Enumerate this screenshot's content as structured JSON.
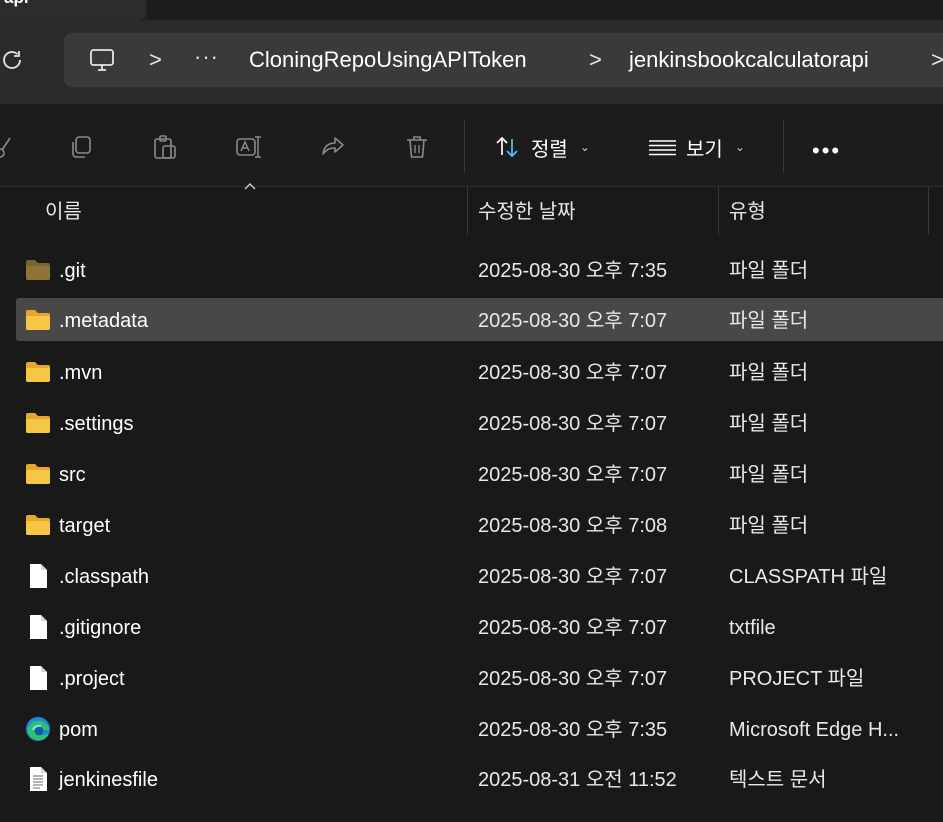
{
  "window": {
    "tab_title": "api"
  },
  "address": {
    "root_icon": "this-pc-icon",
    "overflow": "···",
    "crumbs": [
      "CloningRepoUsingAPIToken",
      "jenkinsbookcalculatorapi"
    ],
    "separator": ">"
  },
  "toolbar": {
    "icons": [
      "cut-icon",
      "copy-icon",
      "paste-icon",
      "rename-icon",
      "share-icon",
      "delete-icon"
    ],
    "sort_label": "정렬",
    "view_label": "보기",
    "more": "•••"
  },
  "columns": {
    "name": "이름",
    "date": "수정한 날짜",
    "type": "유형"
  },
  "files": [
    {
      "name": ".git",
      "date": "2025-08-30 오후 7:35",
      "type": "파일 폴더",
      "icon": "folder-dim-icon"
    },
    {
      "name": ".metadata",
      "date": "2025-08-30 오후 7:07",
      "type": "파일 폴더",
      "icon": "folder-icon",
      "selected": true
    },
    {
      "name": ".mvn",
      "date": "2025-08-30 오후 7:07",
      "type": "파일 폴더",
      "icon": "folder-icon"
    },
    {
      "name": ".settings",
      "date": "2025-08-30 오후 7:07",
      "type": "파일 폴더",
      "icon": "folder-icon"
    },
    {
      "name": "src",
      "date": "2025-08-30 오후 7:07",
      "type": "파일 폴더",
      "icon": "folder-icon"
    },
    {
      "name": "target",
      "date": "2025-08-30 오후 7:08",
      "type": "파일 폴더",
      "icon": "folder-icon"
    },
    {
      "name": ".classpath",
      "date": "2025-08-30 오후 7:07",
      "type": "CLASSPATH 파일",
      "icon": "file-icon"
    },
    {
      "name": ".gitignore",
      "date": "2025-08-30 오후 7:07",
      "type": "txtfile",
      "icon": "file-icon"
    },
    {
      "name": ".project",
      "date": "2025-08-30 오후 7:07",
      "type": "PROJECT 파일",
      "icon": "file-icon"
    },
    {
      "name": "pom",
      "date": "2025-08-30 오후 7:35",
      "type": "Microsoft Edge H...",
      "icon": "edge-icon"
    },
    {
      "name": "jenkinesfile",
      "date": "2025-08-31 오전 11:52",
      "type": "텍스트 문서",
      "icon": "text-file-icon"
    }
  ],
  "colors": {
    "folder": "#f6c744",
    "selected_row": "#484848",
    "background": "#191919"
  }
}
